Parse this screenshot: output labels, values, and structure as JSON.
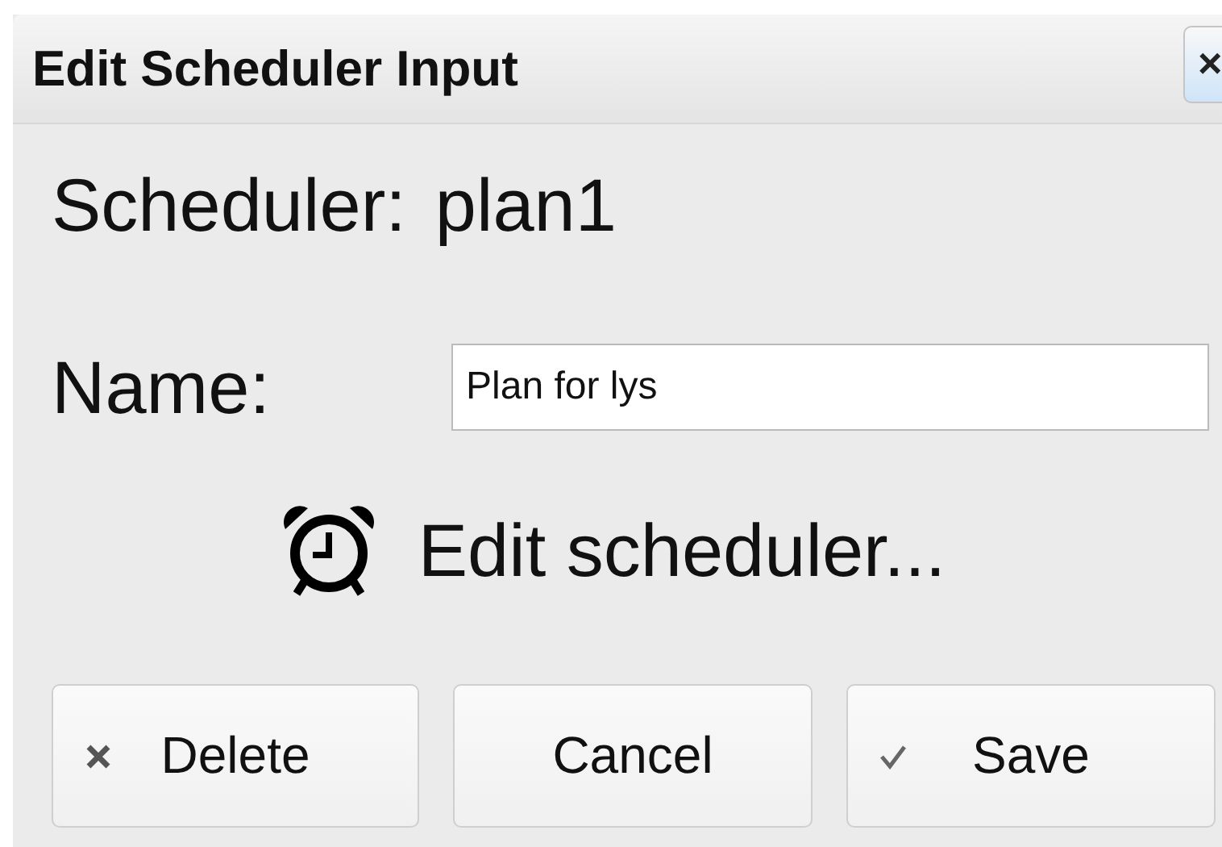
{
  "dialog": {
    "title": "Edit Scheduler Input",
    "close": "×"
  },
  "scheduler": {
    "label": "Scheduler:",
    "value": "plan1"
  },
  "name_field": {
    "label": "Name:",
    "value": "Plan for lys"
  },
  "edit_link": {
    "label": "Edit scheduler..."
  },
  "buttons": [
    {
      "label": "Delete",
      "kind": "delete"
    },
    {
      "label": "Cancel",
      "kind": "plain"
    },
    {
      "label": "Save",
      "kind": "save"
    }
  ]
}
